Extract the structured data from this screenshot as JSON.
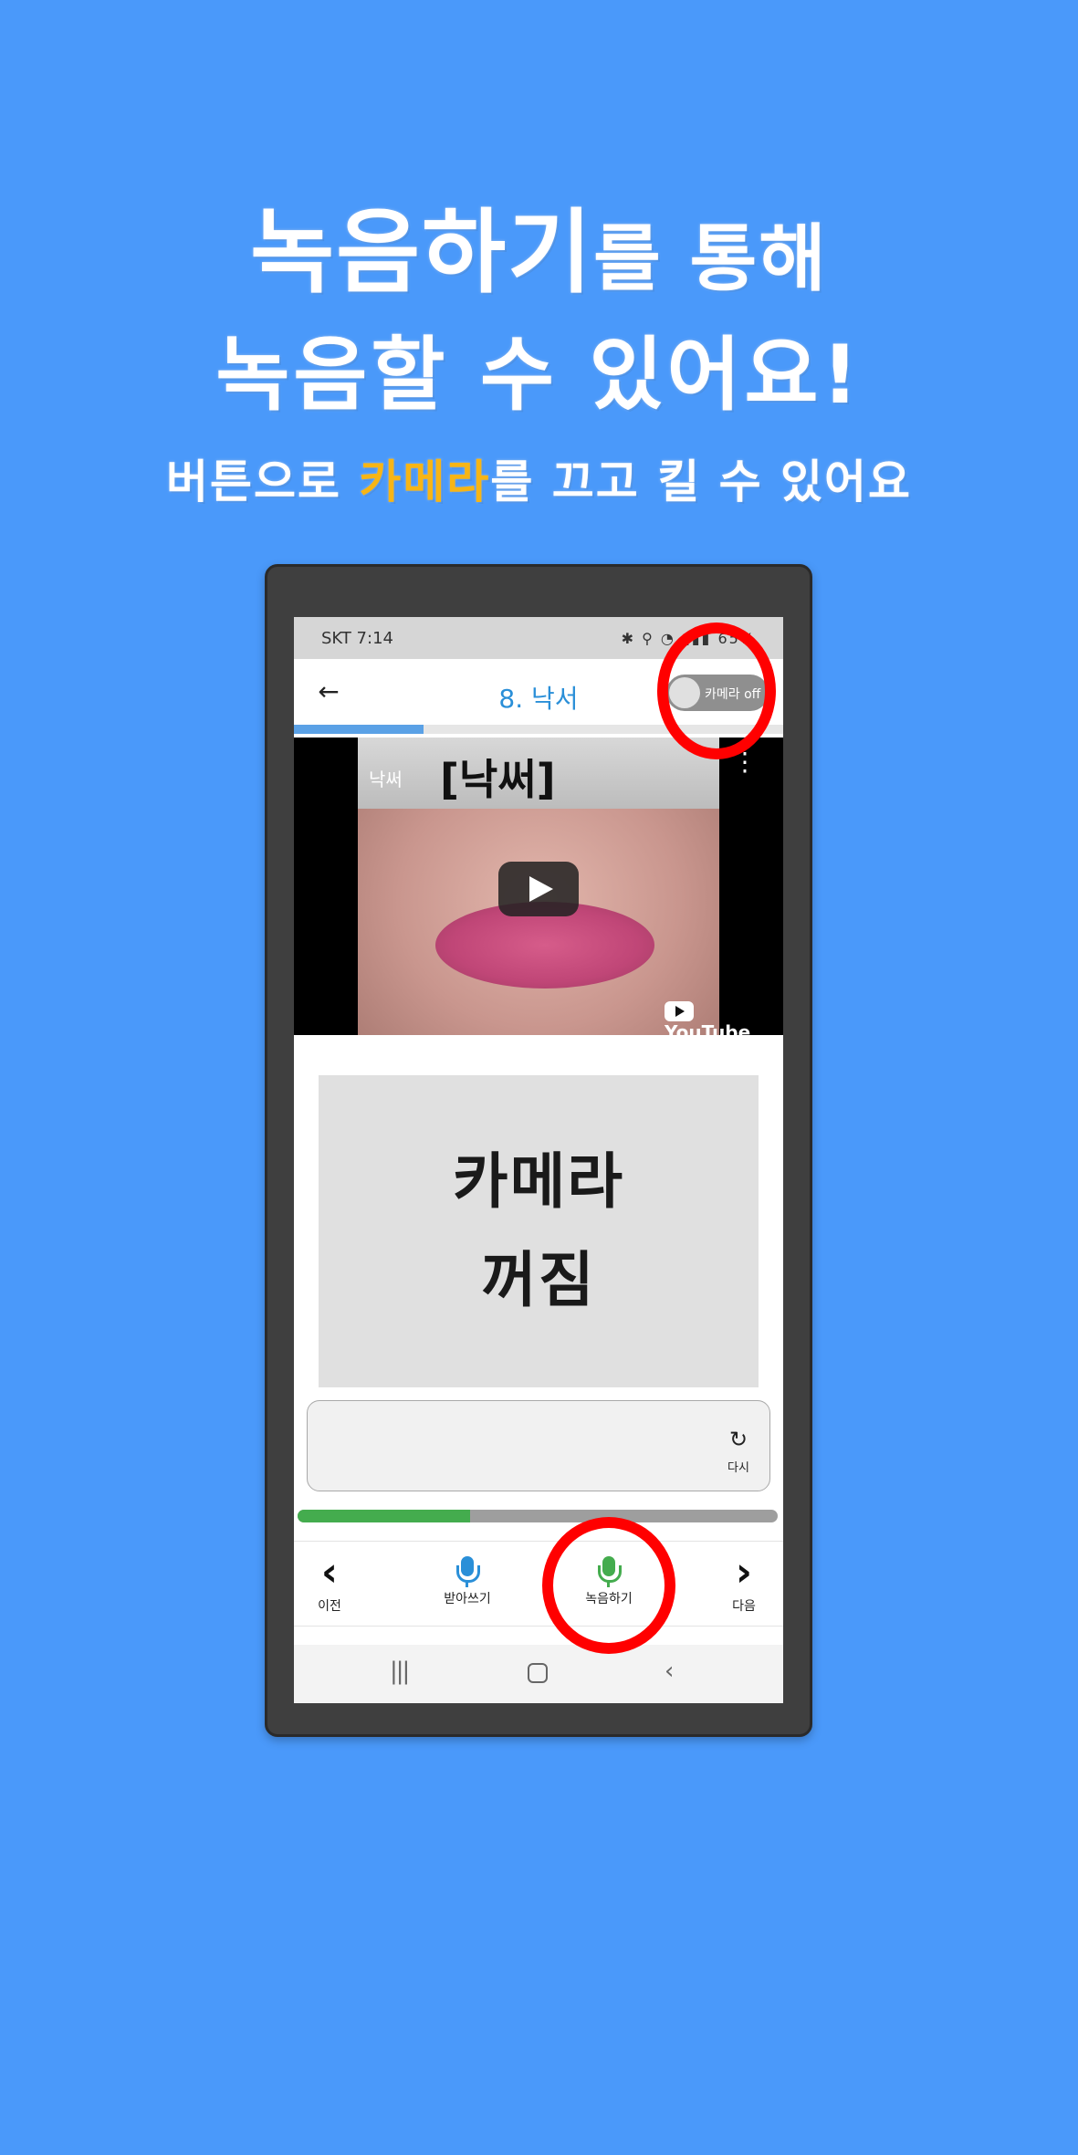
{
  "promo": {
    "headline_bold": "녹음하기",
    "headline_rest": "를 통해",
    "headline_line2": "녹음할 수 있어요!",
    "sub_before": "버튼으로 ",
    "sub_highlight": "카메라",
    "sub_after": "를 끄고 킬 수 있어요",
    "highlight_color": "#f7b515",
    "background_color": "#4a99fa"
  },
  "statusbar": {
    "left": "SKT 7:14",
    "right": "65%"
  },
  "appbar": {
    "back_icon": "arrow-left-icon",
    "title": "8. 낙서",
    "toggle_label": "카메라 off",
    "toggle_on": false
  },
  "progress_top": 0.265,
  "video": {
    "title": "[낙써]",
    "channel_label": "낙써",
    "youtube_label": "YouTube"
  },
  "camera_box": {
    "line1": "카메라",
    "line2": "꺼짐"
  },
  "answer": {
    "value": "",
    "reload_label": "다시"
  },
  "progress_bottom": 0.36,
  "bottom_nav": {
    "prev": "이전",
    "dictation": "받아쓰기",
    "record": "녹음하기",
    "next": "다음"
  },
  "colors": {
    "title_blue": "#2a8fd8",
    "progress_green": "#44ac4e",
    "highlight_circle": "#ff0000"
  }
}
